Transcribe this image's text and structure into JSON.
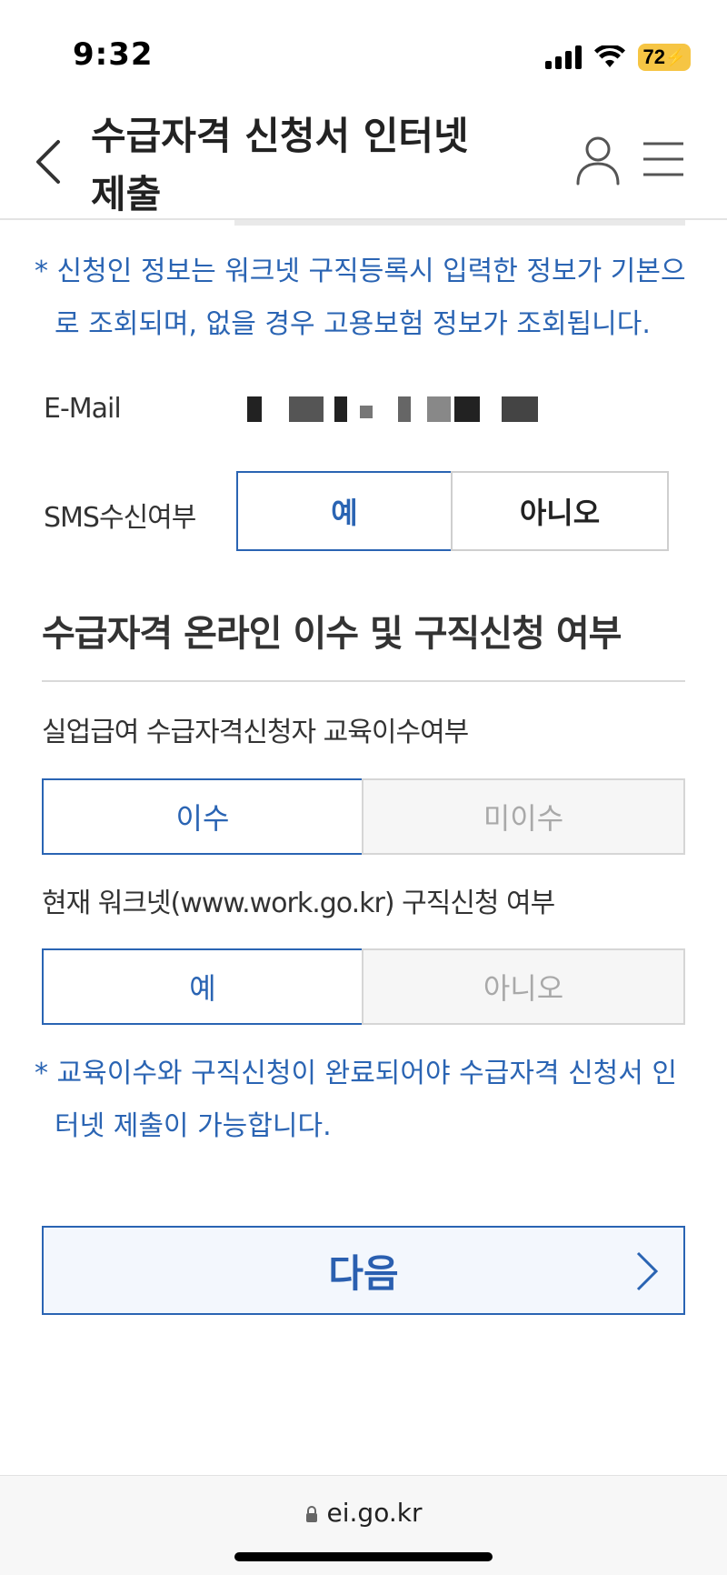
{
  "status": {
    "time": "9:32",
    "battery": "72"
  },
  "header": {
    "title": "수급자격 신청서 인터넷 제출"
  },
  "notes": {
    "applicant_info": "* 신청인 정보는 워크넷 구직등록시 입력한 정보가 기본으로 조회되며, 없을 경우 고용보험 정보가 조회됩니다.",
    "completion": "* 교육이수와 구직신청이 완료되어야 수급자격 신청서 인터넷 제출이 가능합니다."
  },
  "form": {
    "email_label": "E-Mail",
    "sms_label": "SMS수신여부",
    "sms_yes": "예",
    "sms_no": "아니오"
  },
  "section": {
    "title": "수급자격 온라인 이수 및 구직신청 여부",
    "q1_label": "실업급여 수급자격신청자 교육이수여부",
    "q1_selected": "이수",
    "q1_other": "미이수",
    "q2_label": "현재 워크넷(www.work.go.kr) 구직신청 여부",
    "q2_selected": "예",
    "q2_other": "아니오"
  },
  "actions": {
    "next_label": "다음"
  },
  "browser": {
    "url": "ei.go.kr"
  },
  "colors": {
    "accent": "#2a64b3",
    "battery": "#f6c544"
  }
}
